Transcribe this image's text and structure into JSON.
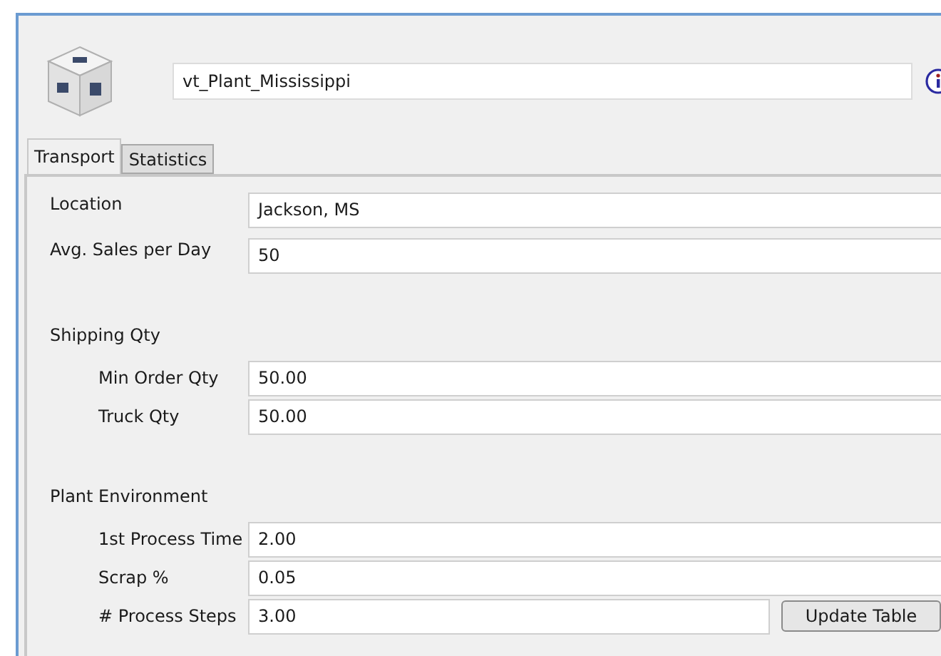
{
  "name_field": {
    "value": "vt_Plant_Mississippi"
  },
  "tabs": [
    {
      "label": "Transport",
      "selected": true
    },
    {
      "label": "Statistics",
      "selected": false
    }
  ],
  "fields": [
    {
      "label": "Location",
      "value": "Jackson, MS"
    },
    {
      "label": "Avg. Sales per Day",
      "value": "50"
    }
  ],
  "groups": [
    {
      "heading": "Shipping Qty",
      "fields": [
        {
          "label": "Min Order Qty",
          "value": "50.00"
        },
        {
          "label": "Truck Qty",
          "value": "50.00"
        }
      ]
    },
    {
      "heading": "Plant Environment",
      "fields": [
        {
          "label": "1st Process Time",
          "value": "2.00"
        },
        {
          "label": "Scrap %",
          "value": "0.05"
        },
        {
          "label": "# Process Steps",
          "value": "3.00",
          "button": "Update Table"
        }
      ]
    }
  ]
}
